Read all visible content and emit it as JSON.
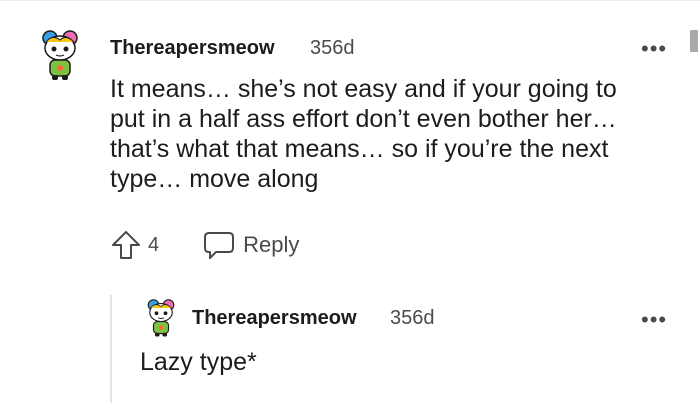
{
  "comment": {
    "username": "Thereapersmeow",
    "age": "356d",
    "text_lines": [
      "It means… she’s not easy and if your going to",
      "put in a half ass effort don’t even bother her…",
      "that’s what that means… so if you’re the next",
      "type… move along"
    ],
    "upvotes": "4",
    "reply_label": "Reply",
    "more_label": "•••"
  },
  "reply": {
    "username": "Thereapersmeow",
    "age": "356d",
    "text": "Lazy type*",
    "more_label": "•••"
  }
}
